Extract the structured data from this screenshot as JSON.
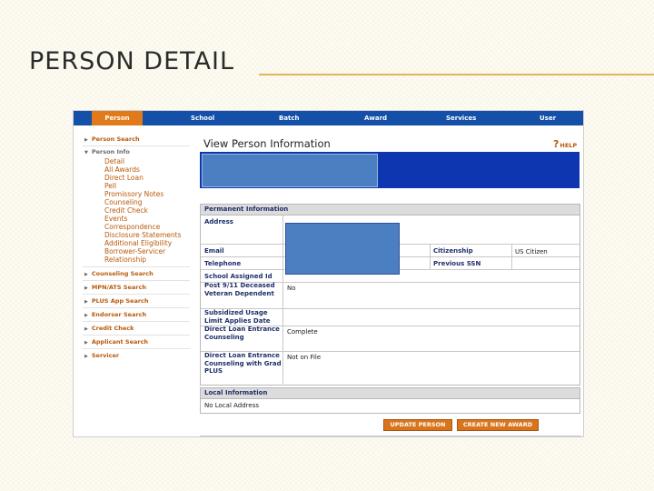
{
  "slide": {
    "title": "PERSON DETAIL"
  },
  "nav": {
    "tabs": [
      "Person",
      "School",
      "Batch",
      "Award",
      "Services",
      "User"
    ],
    "active": "Person"
  },
  "sidebar": {
    "items": [
      {
        "label": "Person Search",
        "state": "collapsed"
      },
      {
        "label": "Person Info",
        "state": "expanded",
        "children": [
          "Detail",
          "All Awards",
          "Direct Loan",
          "Pell",
          "Promissory Notes",
          "Counseling",
          "Credit Check",
          "Events",
          "Correspondence",
          "Disclosure Statements",
          "Additional Eligibility",
          "Borrower-Servicer Relationship"
        ]
      },
      {
        "label": "Counseling Search",
        "state": "collapsed"
      },
      {
        "label": "MPN/ATS Search",
        "state": "collapsed"
      },
      {
        "label": "PLUS App Search",
        "state": "collapsed"
      },
      {
        "label": "Endorser Search",
        "state": "collapsed"
      },
      {
        "label": "Credit Check",
        "state": "collapsed"
      },
      {
        "label": "Applicant Search",
        "state": "collapsed"
      },
      {
        "label": "Servicer",
        "state": "collapsed"
      }
    ]
  },
  "main": {
    "heading": "View Person Information",
    "help_label": "HELP",
    "help_glyph": "?",
    "permanent": {
      "title": "Permanent Information",
      "rows": [
        {
          "label": "Address",
          "value": ""
        },
        {
          "label": "Email",
          "value": "",
          "label2": "Citizenship",
          "value2": "US Citizen"
        },
        {
          "label": "Telephone",
          "value": "",
          "label2": "Previous SSN",
          "value2": ""
        },
        {
          "label": "School Assigned Id",
          "value": ""
        },
        {
          "label": "Post 9/11 Deceased Veteran Dependent",
          "value": "No"
        },
        {
          "label": "Subsidized Usage Limit Applies Date",
          "value": ""
        },
        {
          "label": "Direct Loan Entrance Counseling",
          "value": "Complete"
        },
        {
          "label": "Direct Loan Entrance Counseling with Grad PLUS",
          "value": "Not on File"
        }
      ]
    },
    "local": {
      "title": "Local Information",
      "value": "No Local Address"
    },
    "buttons": {
      "update": "UPDATE PERSON",
      "create": "CREATE NEW AWARD"
    }
  },
  "colors": {
    "nav_bg": "#1550a8",
    "active_tab": "#e07a1a",
    "link": "#b8590a",
    "banner": "#0d36b0",
    "redaction": "#4a7fc2",
    "button": "#d8751c",
    "title_rule": "#e2b557"
  }
}
